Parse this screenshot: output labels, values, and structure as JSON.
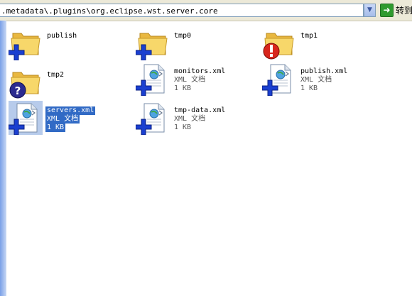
{
  "address_bar": {
    "path": ".metadata\\.plugins\\org.eclipse.wst.server.core",
    "go_label": "转到"
  },
  "files": [
    {
      "name": "publish",
      "kind": "folder",
      "overlay": "plus"
    },
    {
      "name": "tmp0",
      "kind": "folder",
      "overlay": "plus"
    },
    {
      "name": "tmp1",
      "kind": "folder",
      "overlay": "error"
    },
    {
      "name": "tmp2",
      "kind": "folder",
      "overlay": "question"
    },
    {
      "name": "monitors.xml",
      "type": "XML 文档",
      "size": "1 KB",
      "kind": "xml",
      "overlay": "plus"
    },
    {
      "name": "publish.xml",
      "type": "XML 文档",
      "size": "1 KB",
      "kind": "xml",
      "overlay": "plus"
    },
    {
      "name": "servers.xml",
      "type": "XML 文档",
      "size": "1 KB",
      "kind": "xml",
      "overlay": "plus",
      "selected": true
    },
    {
      "name": "tmp-data.xml",
      "type": "XML 文档",
      "size": "1 KB",
      "kind": "xml",
      "overlay": "plus"
    }
  ],
  "colors": {
    "selection": "#316ac5",
    "plus_overlay": "#1a3fd0",
    "error_overlay": "#d8261c",
    "question_overlay": "#2a2a90",
    "folder": "#f2cf5b"
  }
}
